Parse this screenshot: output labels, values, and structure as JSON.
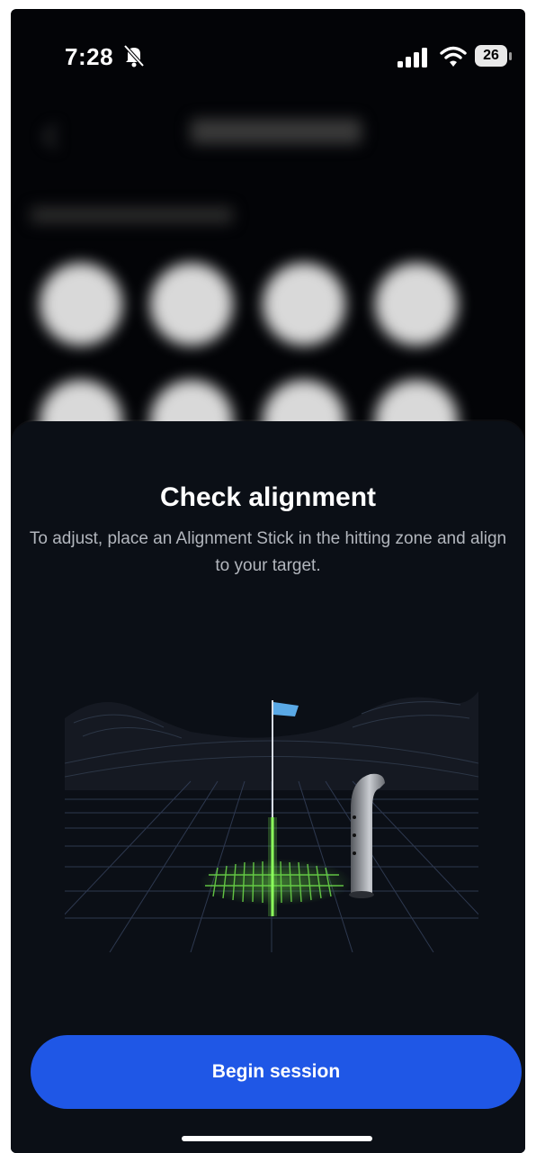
{
  "status_bar": {
    "time": "7:28",
    "bell_icon": "bell-slash-icon",
    "signal_icon": "cellular-signal-icon",
    "wifi_icon": "wifi-icon",
    "battery_level": "26"
  },
  "sheet": {
    "title": "Check alignment",
    "description": "To adjust, place an Alignment Stick in the hitting zone and align to your target.",
    "illustration_icon": "alignment-illustration"
  },
  "cta": {
    "label": "Begin session"
  },
  "colors": {
    "background": "#030407",
    "sheet": "#0b0f16",
    "accent": "#1f57e6",
    "alignment_green": "#6fe04a",
    "flag_blue": "#5aa9e6"
  }
}
